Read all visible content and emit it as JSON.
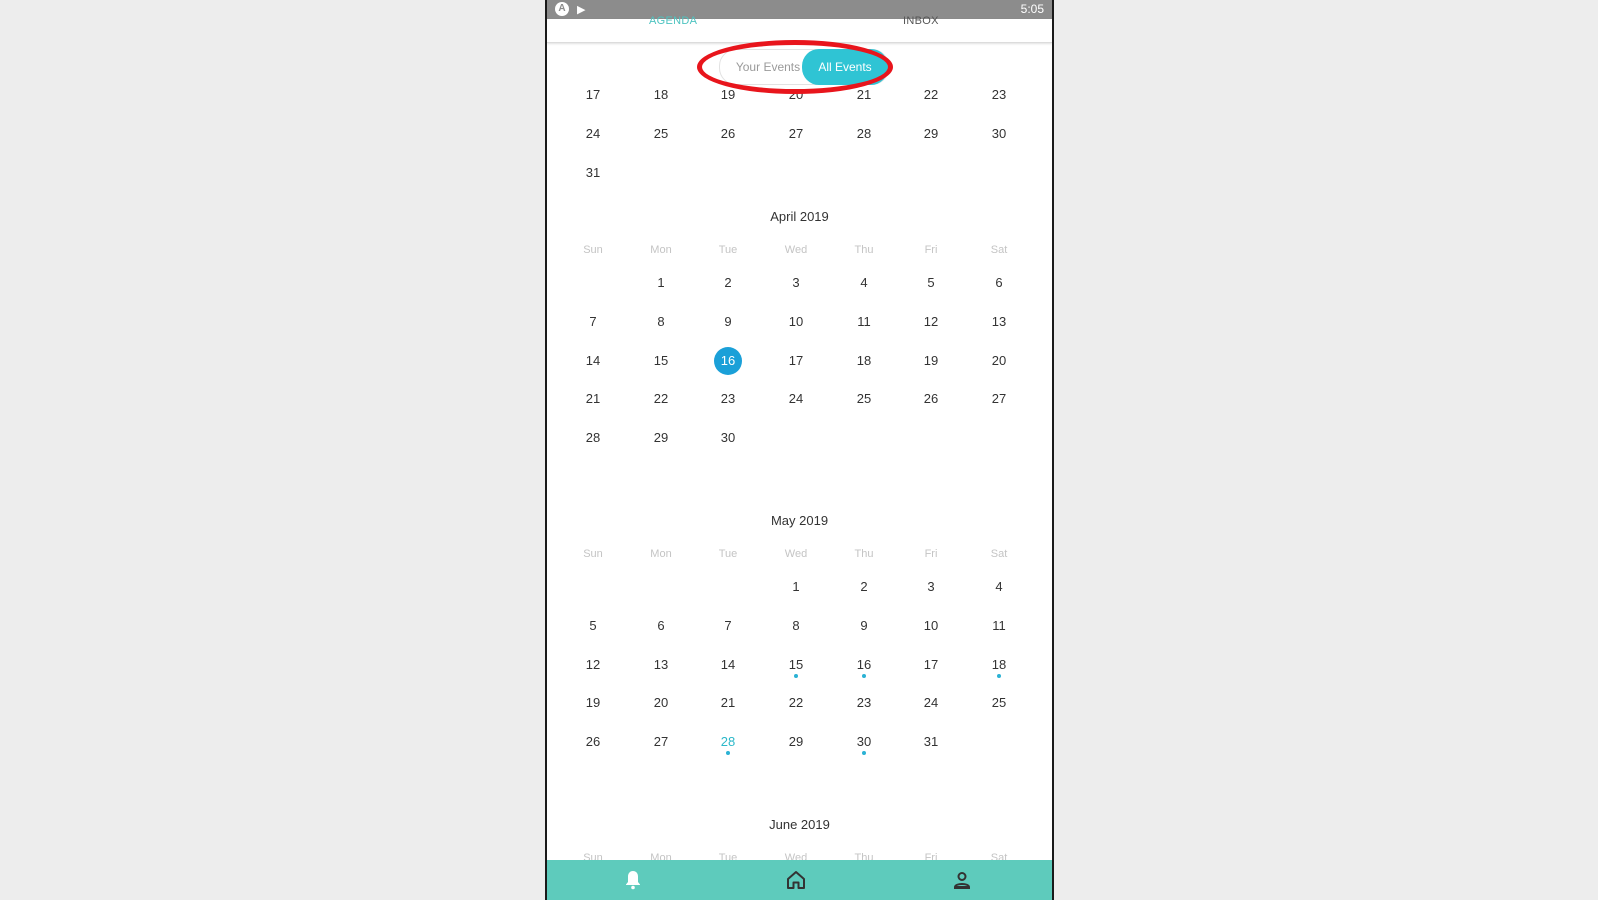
{
  "status_bar": {
    "time": "5:05",
    "icon_a": "A",
    "icon_play": "▶"
  },
  "top_nav": {
    "agenda": "AGENDA",
    "inbox": "INBOX"
  },
  "toggle": {
    "your_events": "Your Events",
    "all_events": "All Events"
  },
  "weekdays": [
    "Sun",
    "Mon",
    "Tue",
    "Wed",
    "Thu",
    "Fri",
    "Sat"
  ],
  "march_partial": {
    "rows": [
      [
        "17",
        "18",
        "19",
        "20",
        "21",
        "22",
        "23"
      ],
      [
        "24",
        "25",
        "26",
        "27",
        "28",
        "29",
        "30"
      ],
      [
        "31"
      ]
    ]
  },
  "april": {
    "title": "April 2019",
    "first_weekday": 1,
    "days": 30,
    "selected": 16
  },
  "may": {
    "title": "May 2019",
    "first_weekday": 3,
    "days": 31,
    "event_dots": [
      15,
      16,
      18,
      28,
      30
    ],
    "accent_day": 28
  },
  "june": {
    "title": "June 2019"
  },
  "colors": {
    "accent_teal": "#4dc3c0",
    "toggle_active": "#2fc4d4",
    "selected_day": "#1ba0d8",
    "bottom_bar": "#5ecbbc",
    "highlight_ring": "#e8151c"
  },
  "bottom_nav": [
    "bell-icon",
    "home-icon",
    "person-icon"
  ]
}
